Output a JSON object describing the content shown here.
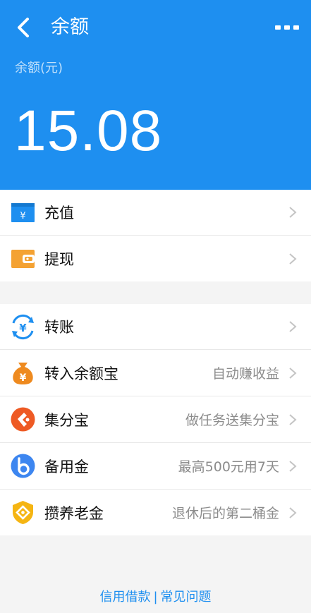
{
  "header": {
    "title": "余额",
    "balance_label": "余额(元)",
    "balance_amount": "15.08"
  },
  "group1": [
    {
      "label": "充值",
      "icon": "recharge-card-icon"
    },
    {
      "label": "提现",
      "icon": "wallet-icon"
    }
  ],
  "group2": [
    {
      "label": "转账",
      "hint": "",
      "icon": "transfer-yuan-icon"
    },
    {
      "label": "转入余额宝",
      "hint": "自动赚收益",
      "icon": "money-bag-icon"
    },
    {
      "label": "集分宝",
      "hint": "做任务送集分宝",
      "icon": "points-icon"
    },
    {
      "label": "备用金",
      "hint": "最高500元用7天",
      "icon": "b-coin-icon"
    },
    {
      "label": "攒养老金",
      "hint": "退休后的第二桶金",
      "icon": "pension-shield-icon"
    }
  ],
  "footer": {
    "credit_link": "信用借款",
    "separator": "|",
    "faq_link": "常见问题"
  },
  "colors": {
    "brand_blue": "#1e8ff0",
    "wallet_orange": "#f4a233",
    "bag_orange": "#ee8a1f",
    "points_red": "#ee5a24",
    "b_blue": "#3d86f0",
    "pension_gold": "#f5b513"
  }
}
